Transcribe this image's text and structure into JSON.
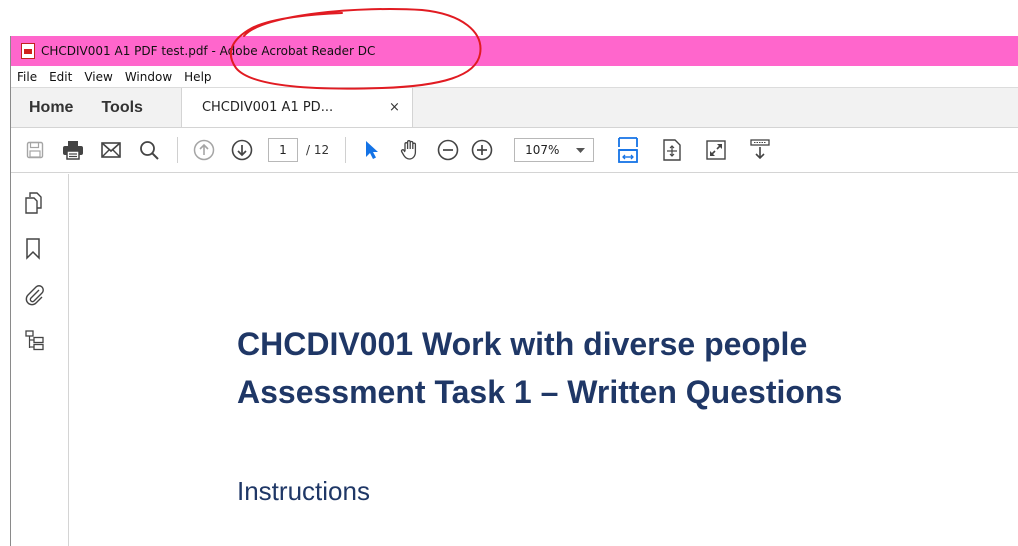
{
  "app": {
    "title_file": "CHCDIV001 A1 PDF test.pdf",
    "title_sep": " - ",
    "title_app": "Adobe Acrobat Reader DC",
    "title_color": "#ff66cc"
  },
  "menu": [
    "File",
    "Edit",
    "View",
    "Window",
    "Help"
  ],
  "tabs": {
    "home": "Home",
    "tools": "Tools",
    "document": "CHCDIV001 A1 PD...",
    "close": "×"
  },
  "toolbar": {
    "page_current": "1",
    "page_total": "/ 12",
    "zoom": "107%",
    "icons": [
      "save-icon",
      "print-icon",
      "email-icon",
      "search-icon",
      "prev-page-icon",
      "next-page-icon",
      "select-icon",
      "hand-icon",
      "zoom-out-icon",
      "zoom-in-icon",
      "fit-width-icon",
      "fit-page-icon",
      "fullscreen-icon",
      "more-tools-icon"
    ]
  },
  "leftrail": {
    "icons": [
      "pages-icon",
      "bookmark-icon",
      "attachment-icon",
      "layers-icon"
    ]
  },
  "document": {
    "title_line1": "CHCDIV001 Work with diverse people",
    "title_line2": "Assessment Task 1 – Written Questions",
    "section": "Instructions",
    "text_color": "#1f3766"
  }
}
